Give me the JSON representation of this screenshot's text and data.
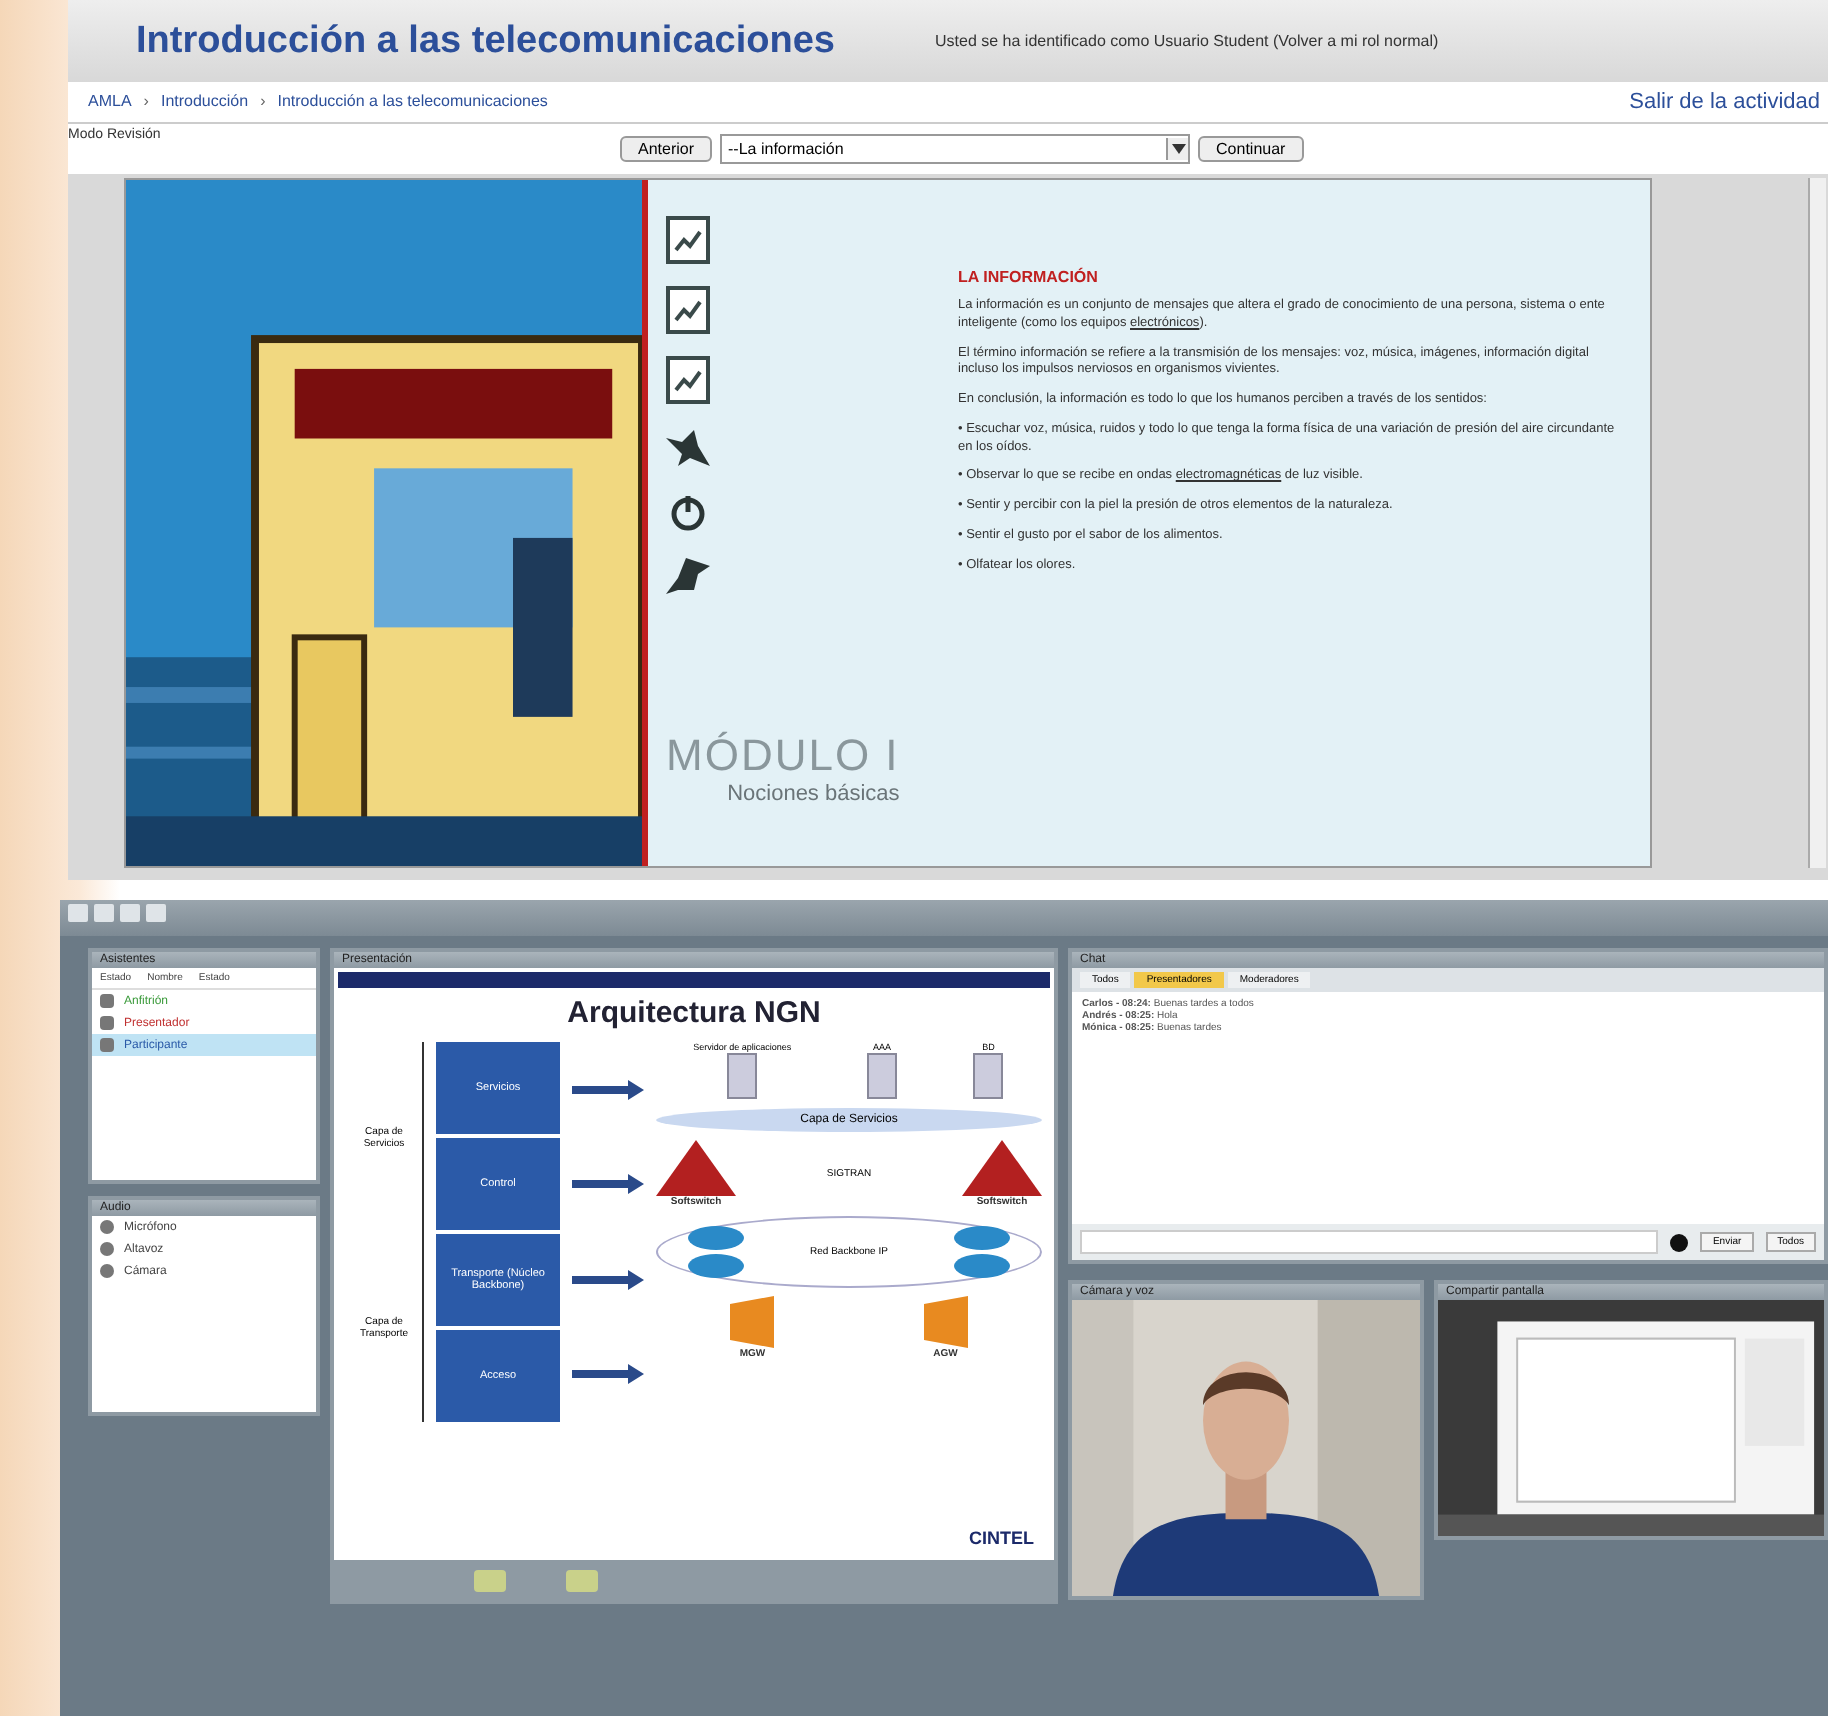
{
  "course_header": {
    "title": "Introducción a las telecomunicaciones",
    "user_notice": "Usted se ha identificado como Usuario Student (Volver a mi rol normal)"
  },
  "breadcrumb": [
    "AMLA",
    "Introducción",
    "Introducción a las telecomunicaciones"
  ],
  "breadcrumb_separator": "›",
  "exit_link": "Salir de la actividad",
  "mode_label": "Modo Revisión",
  "nav": {
    "previous": "Anterior",
    "page_select": "--La información",
    "next": "Continuar"
  },
  "lesson": {
    "module_label": "MÓDULO I",
    "module_subtitle": "Nociones básicas",
    "heading": "LA INFORMACIÓN",
    "paragraphs": [
      [
        {
          "kind": "plain",
          "text": "La información es un conjunto de mensajes que altera el grado de conocimiento de una persona, sistema o ente inteligente (como los equipos "
        },
        {
          "kind": "link",
          "text": "electrónicos"
        },
        {
          "kind": "plain",
          "text": ")."
        }
      ],
      [
        {
          "kind": "plain",
          "text": "El término información se refiere a la transmisión de los mensajes: voz, música, imágenes, información digital incluso los impulsos nerviosos en organismos vivientes."
        }
      ],
      [
        {
          "kind": "plain",
          "text": "En conclusión, la información es todo lo que los humanos perciben a través de los sentidos:"
        }
      ],
      [
        {
          "kind": "plain",
          "text": "• Escuchar voz, música, ruidos y todo lo que tenga la forma física de una variación de presión del aire circundante en los oídos."
        }
      ],
      [
        {
          "kind": "plain",
          "text": "• Observar lo que se recibe en ondas "
        },
        {
          "kind": "link",
          "text": "electromagnéticas"
        },
        {
          "kind": "plain",
          "text": " de luz visible."
        }
      ],
      [
        {
          "kind": "plain",
          "text": "• Sentir y percibir con la piel la presión de otros elementos de la naturaleza."
        }
      ],
      [
        {
          "kind": "plain",
          "text": "• Sentir el gusto por el sabor de los alimentos."
        }
      ],
      [
        {
          "kind": "plain",
          "text": "• Olfatear los olores."
        }
      ]
    ]
  },
  "meeting": {
    "attendees_pod": {
      "title": "Asistentes",
      "columns": [
        "Estado",
        "Nombre",
        "Estado"
      ],
      "rows": [
        {
          "name": "Anfitrión",
          "color": "#3a9a3a",
          "selected": false
        },
        {
          "name": "Presentador",
          "color": "#c03030",
          "selected": false
        },
        {
          "name": "Participante",
          "color": "#2a5aa8",
          "selected": true
        }
      ]
    },
    "audio_pod": {
      "title": "Audio",
      "items": [
        "Micrófono",
        "Altavoz",
        "Cámara"
      ]
    },
    "share_pod": {
      "title": "Presentación",
      "slide": {
        "title": "Arquitectura NGN",
        "layer_labels": [
          "Capa de Servicios",
          "Capa de Transporte"
        ],
        "blocks": [
          "Servicios",
          "Control",
          "Transporte (Núcleo Backbone)",
          "Acceso"
        ],
        "servers": [
          "Servidor de aplicaciones",
          "AAA",
          "BD"
        ],
        "service_cloud": "Capa de Servicios",
        "softswitches": [
          "Softswitch",
          "Softswitch"
        ],
        "signal_label": "SIGTRAN",
        "network_label": "Red Backbone IP",
        "gateways": [
          "MGW",
          "AGW"
        ],
        "logo": "CINTEL"
      }
    },
    "chat_pod": {
      "title": "Chat",
      "tabs": [
        {
          "label": "Todos",
          "selected": false
        },
        {
          "label": "Presentadores",
          "selected": true
        },
        {
          "label": "Moderadores",
          "selected": false
        }
      ],
      "messages": [
        {
          "sender": "Carlos - 08:24:",
          "text": "Buenas tardes a todos"
        },
        {
          "sender": "Andrés - 08:25:",
          "text": "Hola"
        },
        {
          "sender": "Mónica - 08:25:",
          "text": "Buenas tardes"
        }
      ],
      "send": "Enviar",
      "target": "Todos"
    },
    "camera_pod": {
      "title": "Cámara y voz"
    },
    "screen_pod": {
      "title": "Compartir pantalla"
    }
  }
}
